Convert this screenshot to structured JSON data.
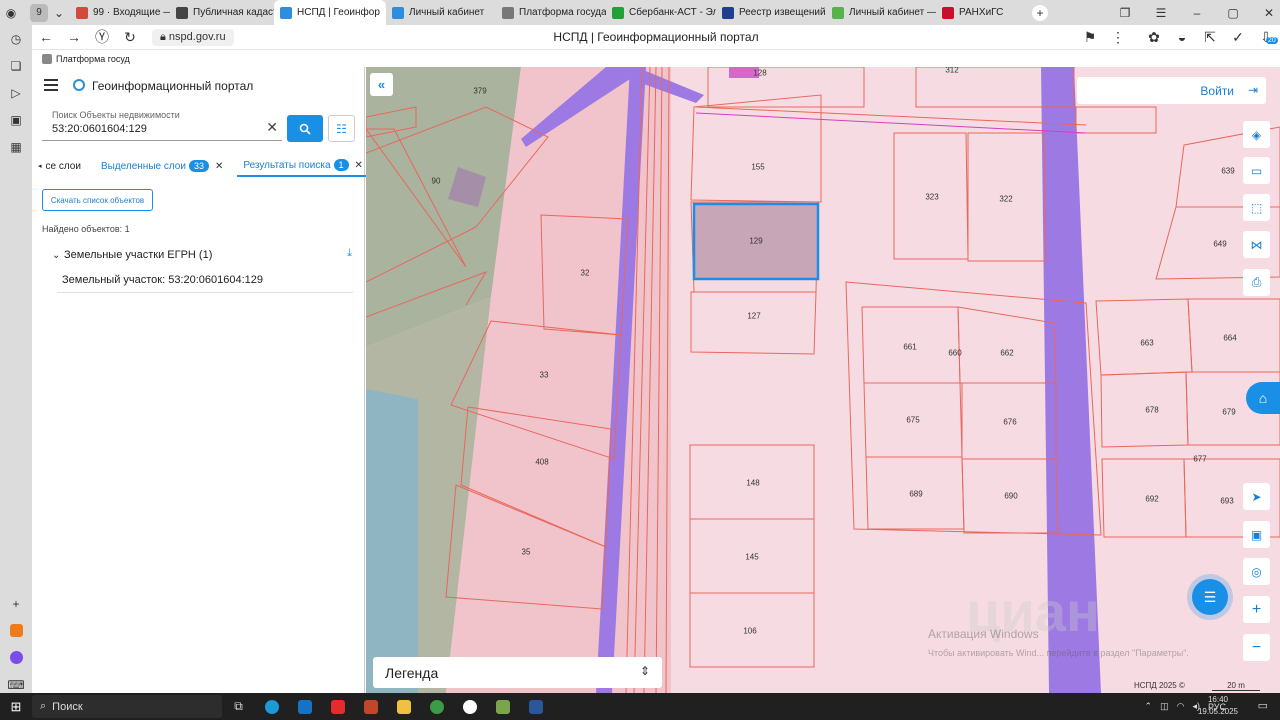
{
  "browser": {
    "tab_count_badge": "9",
    "tabs": [
      {
        "label": "99 · Входящие — Ян",
        "color": "#d24a3c"
      },
      {
        "label": "Публичная кадастр",
        "color": "#444444"
      },
      {
        "label": "НСПД | Геоинфор",
        "color": "#2b8ede"
      },
      {
        "label": "Личный кабинет",
        "color": "#2b8ede"
      },
      {
        "label": "Платформа государ",
        "color": "#777777"
      },
      {
        "label": "Сбербанк-АСТ - Эл",
        "color": "#21a038"
      },
      {
        "label": "Реестр извещений",
        "color": "#1f3f8f"
      },
      {
        "label": "Личный кабинет —",
        "color": "#56b34a"
      },
      {
        "label": "РАНХиГС",
        "color": "#c8102e"
      }
    ],
    "active_tab_close": "✕",
    "new_tab": "+",
    "url": "nspd.gov.ru",
    "page_title": "НСПД | Геоинформационный портал",
    "bookmark": "Платформа госуд",
    "extension_badge": "20"
  },
  "panel": {
    "app_title": "Геоинформационный портал",
    "search": {
      "label": "Поиск Объекты недвижимости",
      "value": "53:20:0601604:129",
      "clear": "✕"
    },
    "tabs": [
      {
        "label": "се слои",
        "badge": "",
        "close": ""
      },
      {
        "label": "Выделенные слои",
        "badge": "33",
        "close": "✕"
      },
      {
        "label": "Результаты поиска",
        "badge": "1",
        "close": "✕"
      }
    ],
    "download_button": "Скачать список объектов",
    "found_count": "Найдено объектов: 1",
    "group": {
      "label": "Земельные участки ЕГРН (1)"
    },
    "result_item": "Земельный участок: 53:20:0601604:129"
  },
  "map": {
    "login_label": "Войти",
    "legend_label": "Легенда",
    "watermark_title": "Активация Windows",
    "watermark_sub": "Чтобы активировать Wind... перейдите в раздел \"Параметры\".",
    "copyright": "НСПД 2025 ©",
    "scale": "20 m",
    "highlight_color": "#1a8fe6",
    "parcel_color": "#e8675c",
    "road_color": "#9d7ae3",
    "parcel_labels": [
      "379",
      "128",
      "312",
      "90",
      "155",
      "323",
      "322",
      "639",
      "129",
      "32",
      "649",
      "127",
      "661",
      "660",
      "662",
      "663",
      "664",
      "33",
      "675",
      "676",
      "678",
      "679",
      "408",
      "677",
      "148",
      "689",
      "690",
      "692",
      "693",
      "145",
      "35",
      "106"
    ]
  },
  "taskbar": {
    "search_label": "Поиск",
    "language": "РУС",
    "time": "16:40",
    "date": "19.05.2025"
  }
}
